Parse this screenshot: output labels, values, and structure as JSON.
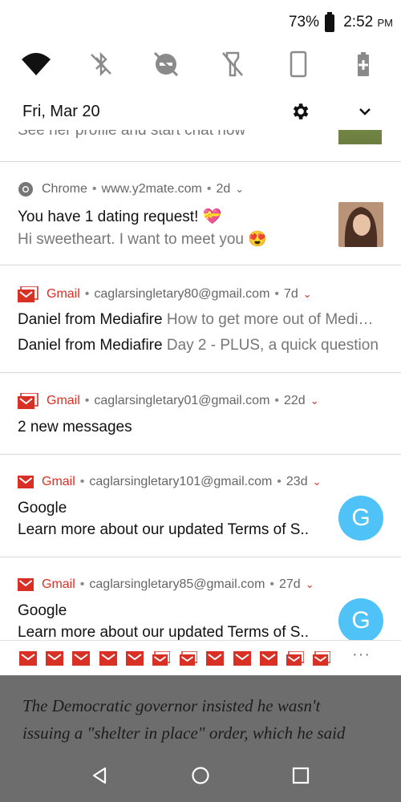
{
  "status_bar": {
    "battery_pct": "73%",
    "time": "2:52",
    "ampm": "PM"
  },
  "quick_settings": {
    "icons": [
      "wifi-icon",
      "bluetooth-off-icon",
      "do-not-disturb-off-icon",
      "flashlight-off-icon",
      "auto-rotate-icon",
      "battery-saver-icon"
    ]
  },
  "date_row": {
    "date": "Fri, Mar 20"
  },
  "partial_notification": {
    "text": "See her profile and start chat now"
  },
  "notifications": [
    {
      "app": "Chrome",
      "source": "www.y2mate.com",
      "age": "2d",
      "title": "You have 1 dating request! 💝",
      "subtitle": "Hi sweetheart. I want to meet you 😍"
    },
    {
      "app": "Gmail",
      "source": "caglarsingletary80@gmail.com",
      "age": "7d",
      "lines": [
        {
          "sender": "Daniel from Mediafire",
          "preview": "How to get more out of Medi…"
        },
        {
          "sender": "Daniel from Mediafire",
          "preview": "Day 2 - PLUS, a quick question"
        }
      ]
    },
    {
      "app": "Gmail",
      "source": "caglarsingletary01@gmail.com",
      "age": "22d",
      "summary": "2 new messages"
    },
    {
      "app": "Gmail",
      "source": "caglarsingletary101@gmail.com",
      "age": "23d",
      "sender": "Google",
      "preview": "Learn more about our updated Terms of S..",
      "avatar_letter": "G"
    },
    {
      "app": "Gmail",
      "source": "caglarsingletary85@gmail.com",
      "age": "27d",
      "sender": "Google",
      "preview": "Learn more about our updated Terms of S..",
      "avatar_letter": "G"
    }
  ],
  "overflow_strip": {
    "icon_count": 12,
    "more": "···"
  },
  "background_article": {
    "line1": "The Democratic governor insisted he wasn't",
    "line2": "issuing a \"shelter in place\" order, which he said"
  },
  "colors": {
    "gmail_red": "#d93025",
    "avatar_blue": "#4fc3f7",
    "scrim": "#6d6d6d"
  }
}
